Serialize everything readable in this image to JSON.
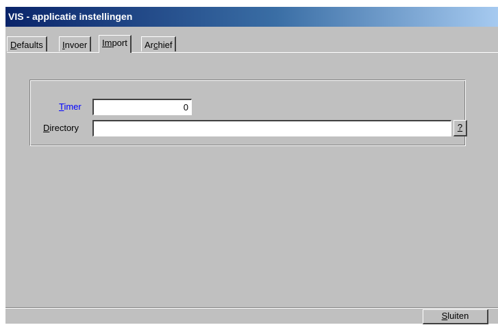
{
  "window": {
    "title": "VIS - applicatie instellingen"
  },
  "tabs": [
    {
      "prefix": "",
      "mnemonic": "D",
      "suffix": "efaults",
      "active": false
    },
    {
      "prefix": "",
      "mnemonic": "I",
      "suffix": "nvoer",
      "active": false
    },
    {
      "prefix": "",
      "mnemonic": "Im",
      "suffix": "port",
      "active": true
    },
    {
      "prefix": "Ar",
      "mnemonic": "c",
      "suffix": "hief",
      "active": false
    }
  ],
  "import": {
    "timer_label_mnemonic": "T",
    "timer_label_rest": "imer",
    "timer_value": "0",
    "directory_label_mnemonic": "D",
    "directory_label_rest": "irectory",
    "directory_value": "",
    "browse_label": "?"
  },
  "footer": {
    "close_mnemonic": "S",
    "close_rest": "luiten"
  },
  "colors": {
    "title_gradient_start": "#0a246a",
    "title_gradient_end": "#a6caf0",
    "required_label": "#0000ff"
  }
}
